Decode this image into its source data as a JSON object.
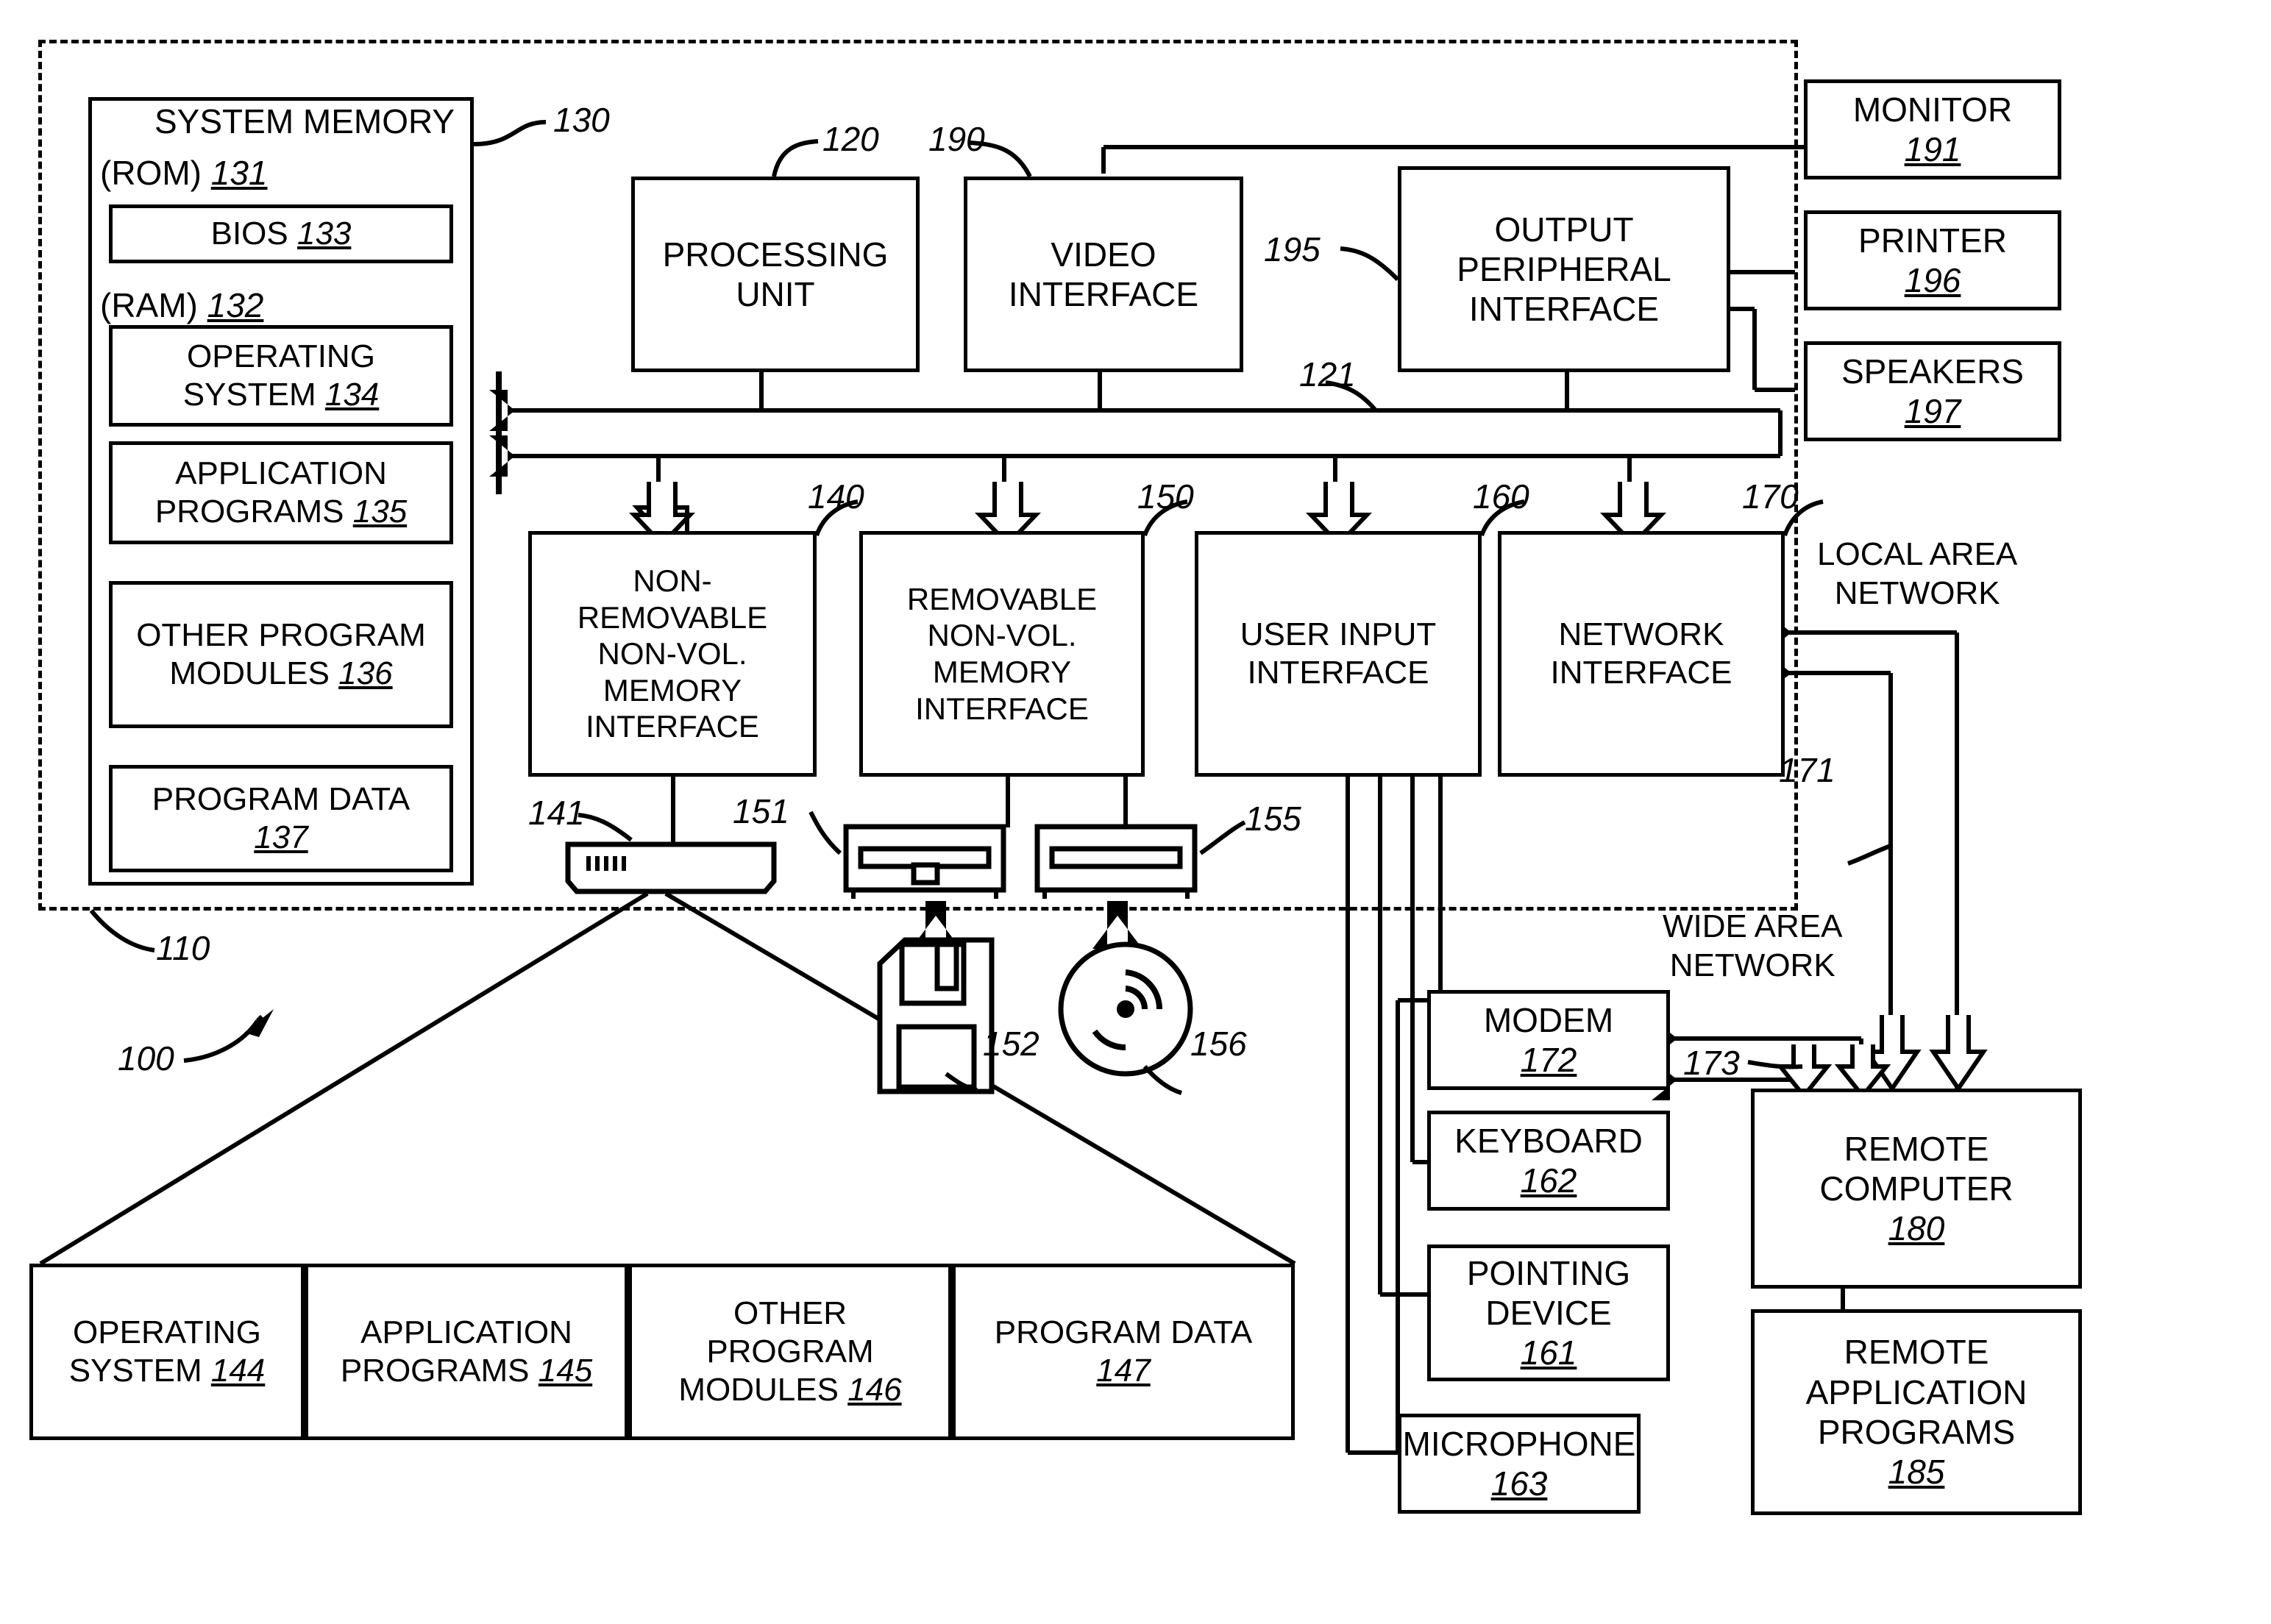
{
  "figure": {
    "kind": "patent-block-diagram",
    "overall_ref": "100",
    "computer_ref": "110"
  },
  "enclosure": {
    "computer_label": "110",
    "system_memory_label": "SYSTEM MEMORY",
    "system_memory_ref": "130",
    "rom_label": "(ROM)",
    "rom_ref": "131",
    "ram_label": "(RAM)",
    "ram_ref": "132"
  },
  "memory_boxes": [
    {
      "lines": [
        "BIOS "
      ],
      "ref": "133",
      "ref_inline": true
    },
    {
      "lines": [
        "OPERATING",
        "SYSTEM "
      ],
      "ref": "134",
      "ref_inline": true
    },
    {
      "lines": [
        "APPLICATION",
        "PROGRAMS "
      ],
      "ref": "135",
      "ref_inline": true
    },
    {
      "lines": [
        "OTHER PROGRAM",
        "MODULES "
      ],
      "ref": "136",
      "ref_inline": true
    },
    {
      "lines": [
        "PROGRAM DATA"
      ],
      "ref": "137",
      "ref_inline": false
    }
  ],
  "core_boxes": {
    "processing_unit": {
      "lines": [
        "PROCESSING",
        "UNIT"
      ],
      "ref": "120"
    },
    "video_interface": {
      "lines": [
        "VIDEO",
        "INTERFACE"
      ],
      "ref": "190"
    },
    "output_peripheral_interface": {
      "lines": [
        "OUTPUT",
        "PERIPHERAL",
        "INTERFACE"
      ],
      "ref": "195"
    },
    "system_bus": {
      "ref": "121"
    },
    "nonremovable_memory_interface": {
      "lines": [
        "NON-",
        "REMOVABLE",
        "NON-VOL.",
        "MEMORY",
        "INTERFACE"
      ],
      "ref": "140"
    },
    "removable_memory_interface": {
      "lines": [
        "REMOVABLE",
        "NON-VOL.",
        "MEMORY",
        "INTERFACE"
      ],
      "ref": "150"
    },
    "user_input_interface": {
      "lines": [
        "USER INPUT",
        "INTERFACE"
      ],
      "ref": "160"
    },
    "network_interface": {
      "lines": [
        "NETWORK",
        "INTERFACE"
      ],
      "ref": "170"
    }
  },
  "drives": {
    "hard_disk_ref": "141",
    "floppy_drive_ref": "151",
    "optical_drive_ref": "155",
    "floppy_disk_ref": "152",
    "optical_disc_ref": "156"
  },
  "output_devices": [
    {
      "lines": [
        "MONITOR"
      ],
      "ref": "191"
    },
    {
      "lines": [
        "PRINTER"
      ],
      "ref": "196"
    },
    {
      "lines": [
        "SPEAKERS"
      ],
      "ref": "197"
    }
  ],
  "input_devices": [
    {
      "lines": [
        "MODEM"
      ],
      "ref": "172"
    },
    {
      "lines": [
        "KEYBOARD"
      ],
      "ref": "162"
    },
    {
      "lines": [
        "POINTING",
        "DEVICE"
      ],
      "ref": "161"
    },
    {
      "lines": [
        "MICROPHONE"
      ],
      "ref": "163"
    }
  ],
  "remote": [
    {
      "lines": [
        "REMOTE",
        "COMPUTER"
      ],
      "ref": "180"
    },
    {
      "lines": [
        "REMOTE",
        "APPLICATION",
        "PROGRAMS"
      ],
      "ref": "185"
    }
  ],
  "networks": {
    "lan_label": "LOCAL AREA\nNETWORK",
    "lan_line1": "LOCAL AREA",
    "lan_line2": "NETWORK",
    "lan_ref": "171",
    "wan_line1": "WIDE AREA",
    "wan_line2": "NETWORK",
    "wan_ref": "173"
  },
  "expanded_storage_boxes": [
    {
      "lines": [
        "OPERATING",
        "SYSTEM "
      ],
      "ref": "144"
    },
    {
      "lines": [
        "APPLICATION",
        "PROGRAMS "
      ],
      "ref": "145"
    },
    {
      "lines": [
        "OTHER",
        "PROGRAM",
        "MODULES "
      ],
      "ref": "146"
    },
    {
      "lines": [
        "PROGRAM DATA"
      ],
      "ref": "147"
    }
  ],
  "colors": {
    "ink": "#000000",
    "paper": "#ffffff"
  }
}
